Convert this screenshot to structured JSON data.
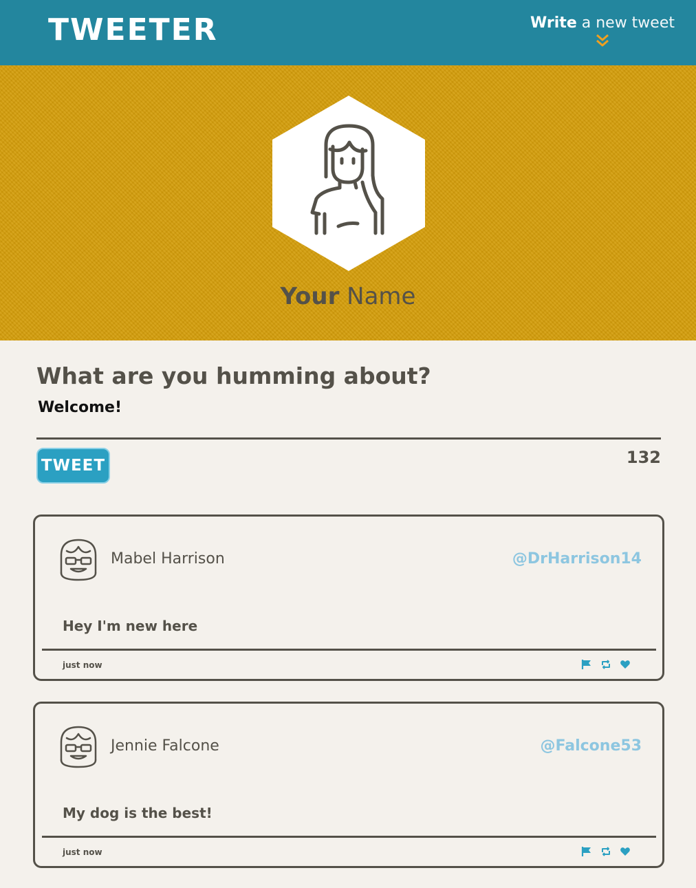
{
  "nav": {
    "logo": "TWEETER",
    "compose_strong": "Write",
    "compose_light": " a new tweet",
    "compose_icon": "double-chevron-down-icon"
  },
  "profile": {
    "first_name": "Your",
    "last_name": " Name",
    "avatar_icon": "user-avatar-icon"
  },
  "compose": {
    "heading": "What are you humming about?",
    "input_value": "Welcome!",
    "button_label": "TWEET",
    "counter": "132"
  },
  "tweets": [
    {
      "name": "Mabel Harrison",
      "handle": "@DrHarrison14",
      "body": "Hey I'm new here",
      "time": "just now"
    },
    {
      "name": "Jennie Falcone",
      "handle": "@Falcone53",
      "body": "My dog is the best!",
      "time": "just now"
    }
  ],
  "colors": {
    "nav_bg": "#23869e",
    "profile_bg": "#d49d0a",
    "page_bg": "#f4f1ec",
    "text": "#545149",
    "accent": "#2ba0c2",
    "handle": "#8dc6e0",
    "chevron": "#f0a020"
  }
}
